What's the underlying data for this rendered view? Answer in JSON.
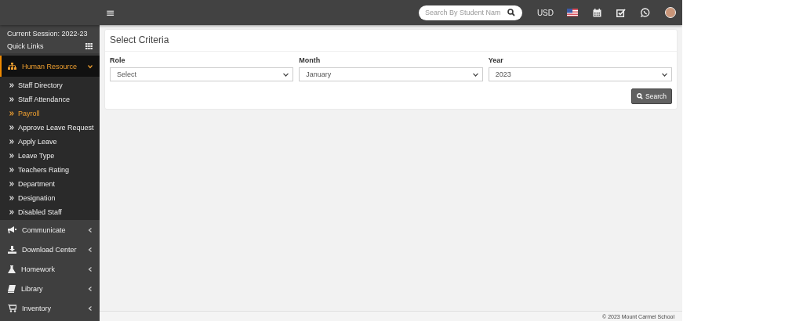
{
  "header": {
    "menu_glyph": "≡",
    "search": {
      "placeholder": "Search By Student Nam"
    },
    "currency": "USD"
  },
  "sidebar": {
    "session": "Current Session: 2022-23",
    "quick_links": "Quick Links",
    "items": [
      {
        "label": "Human Resource",
        "expanded": true,
        "selected": true,
        "children": [
          {
            "label": "Staff Directory",
            "selected": false
          },
          {
            "label": "Staff Attendance",
            "selected": false
          },
          {
            "label": "Payroll",
            "selected": true
          },
          {
            "label": "Approve Leave Request",
            "selected": false
          },
          {
            "label": "Apply Leave",
            "selected": false
          },
          {
            "label": "Leave Type",
            "selected": false
          },
          {
            "label": "Teachers Rating",
            "selected": false
          },
          {
            "label": "Department",
            "selected": false
          },
          {
            "label": "Designation",
            "selected": false
          },
          {
            "label": "Disabled Staff",
            "selected": false
          }
        ]
      },
      {
        "label": "Communicate",
        "expanded": false,
        "selected": false
      },
      {
        "label": "Download Center",
        "expanded": false,
        "selected": false
      },
      {
        "label": "Homework",
        "expanded": false,
        "selected": false
      },
      {
        "label": "Library",
        "expanded": false,
        "selected": false
      },
      {
        "label": "Inventory",
        "expanded": false,
        "selected": false
      }
    ]
  },
  "criteria": {
    "title": "Select Criteria",
    "fields": [
      {
        "label": "Role",
        "value": "Select"
      },
      {
        "label": "Month",
        "value": "January"
      },
      {
        "label": "Year",
        "value": "2023"
      }
    ],
    "button": "Search"
  },
  "footer": "© 2023 Mount Carmel School"
}
